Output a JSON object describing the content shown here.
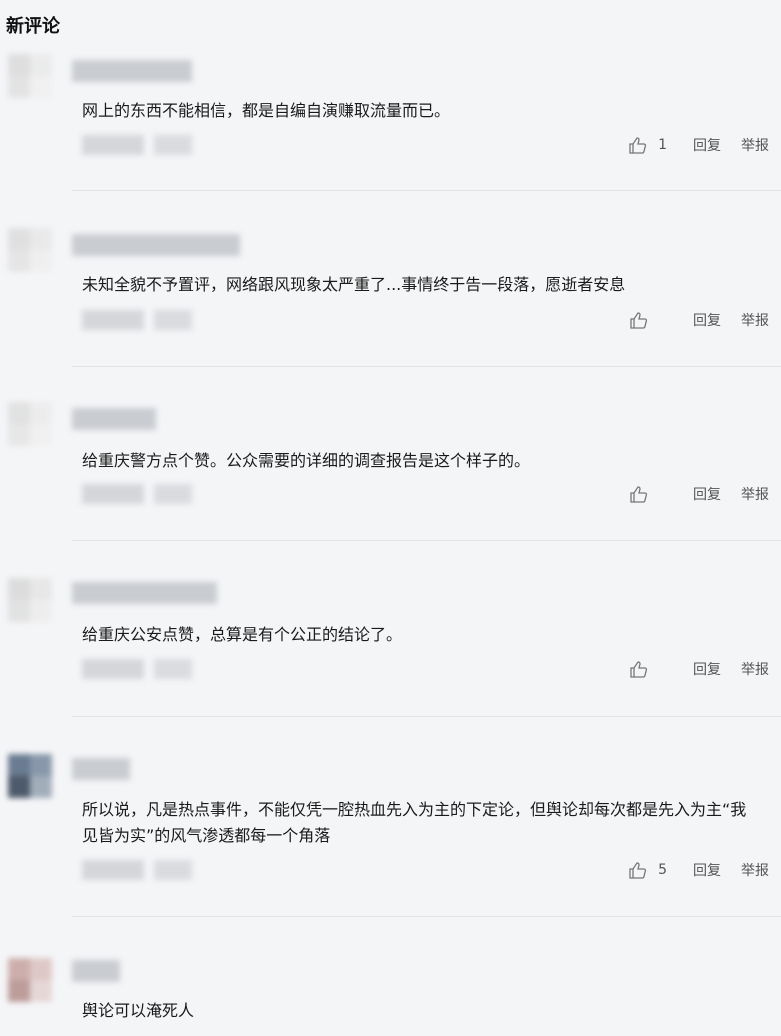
{
  "section_title": "新评论",
  "actions": {
    "reply_label": "回复",
    "report_label": "举报",
    "like_icon": "thumbs-up-icon"
  },
  "comments": [
    {
      "text": "网上的东西不能相信，都是自编自演赚取流量而已。",
      "likes": "1"
    },
    {
      "text": "未知全貌不予置评，网络跟风现象太严重了...事情终于告一段落，愿逝者安息",
      "likes": ""
    },
    {
      "text": "给重庆警方点个赞。公众需要的详细的调查报告是这个样子的。",
      "likes": ""
    },
    {
      "text": "给重庆公安点赞，总算是有个公正的结论了。",
      "likes": ""
    },
    {
      "text": "所以说，凡是热点事件，不能仅凭一腔热血先入为主的下定论，但舆论却每次都是先入为主“我见皆为实”的风气渗透都每一个角落",
      "likes": "5"
    },
    {
      "text": "舆论可以淹死人",
      "likes": ""
    }
  ]
}
